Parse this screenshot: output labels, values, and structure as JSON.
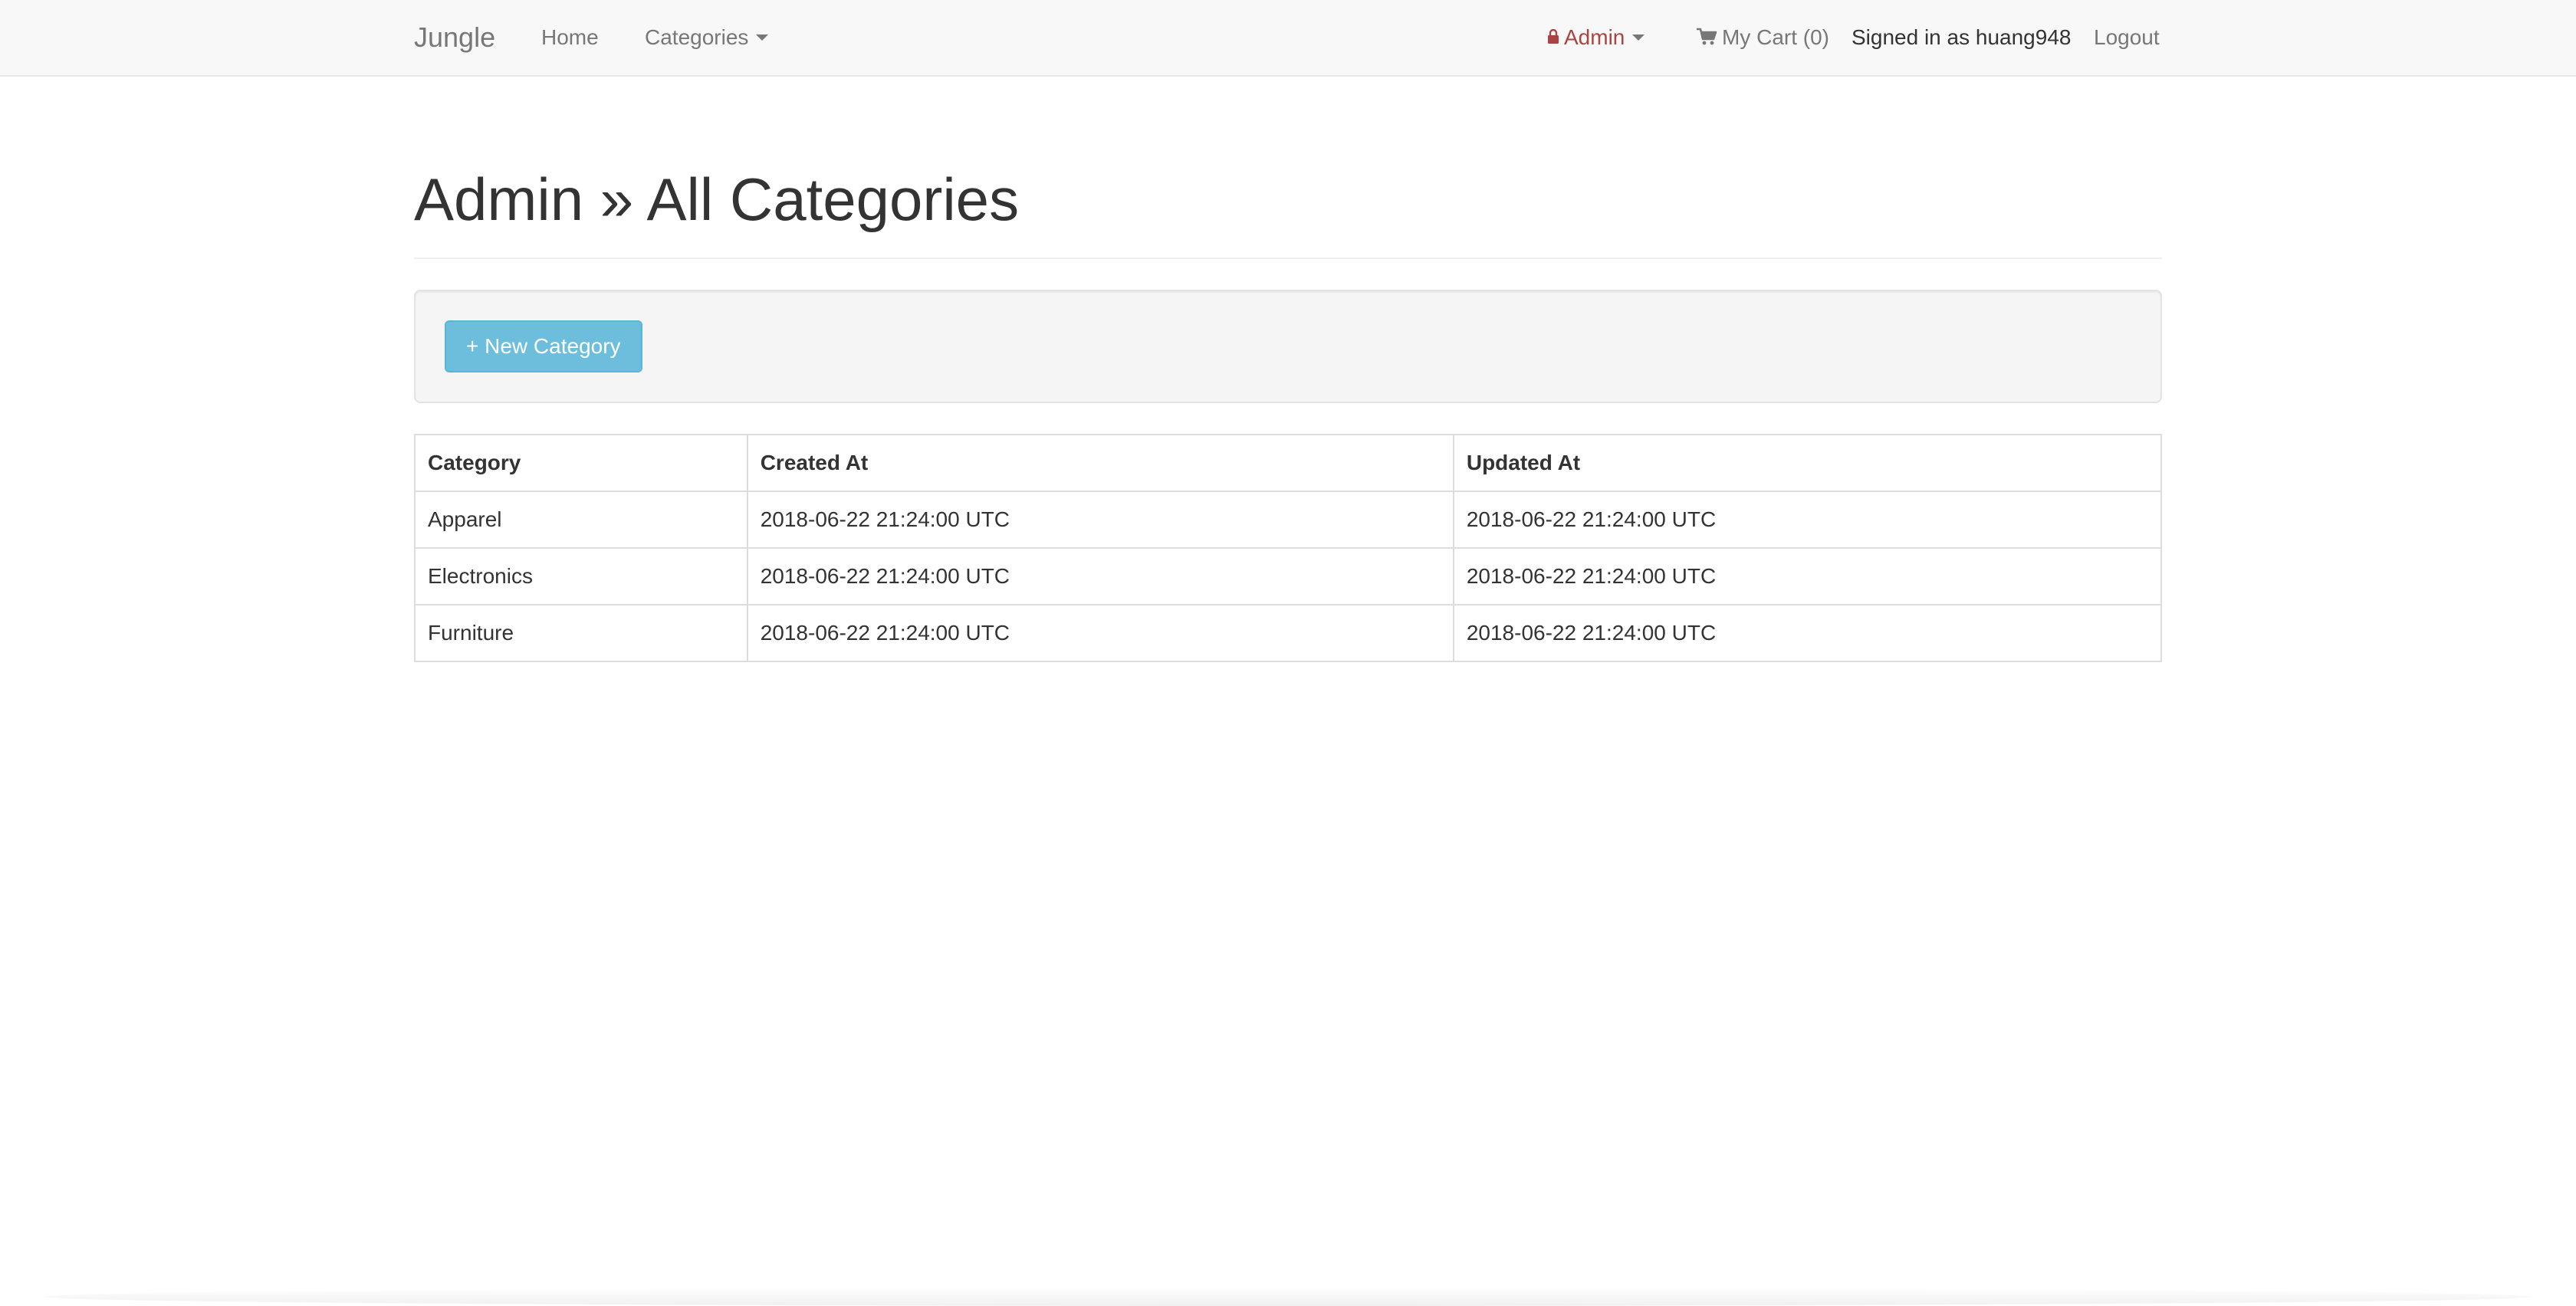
{
  "navbar": {
    "brand": "Jungle",
    "home": "Home",
    "categories": "Categories",
    "admin": "Admin",
    "cart": "My Cart (0)",
    "signed_in": "Signed in as huang948",
    "logout": "Logout",
    "icons": {
      "admin": "lock-icon",
      "cart": "shopping-cart-icon",
      "dropdown": "caret-down-icon"
    },
    "colors": {
      "admin": "#a94442",
      "background": "#f8f8f8"
    }
  },
  "page": {
    "title": "Admin » All Categories"
  },
  "toolbar": {
    "new_category": "+ New Category",
    "button_color": "#6dbedc"
  },
  "table": {
    "headers": [
      "Category",
      "Created At",
      "Updated At"
    ],
    "rows": [
      [
        "Apparel",
        "2018-06-22 21:24:00 UTC",
        "2018-06-22 21:24:00 UTC"
      ],
      [
        "Electronics",
        "2018-06-22 21:24:00 UTC",
        "2018-06-22 21:24:00 UTC"
      ],
      [
        "Furniture",
        "2018-06-22 21:24:00 UTC",
        "2018-06-22 21:24:00 UTC"
      ]
    ]
  }
}
